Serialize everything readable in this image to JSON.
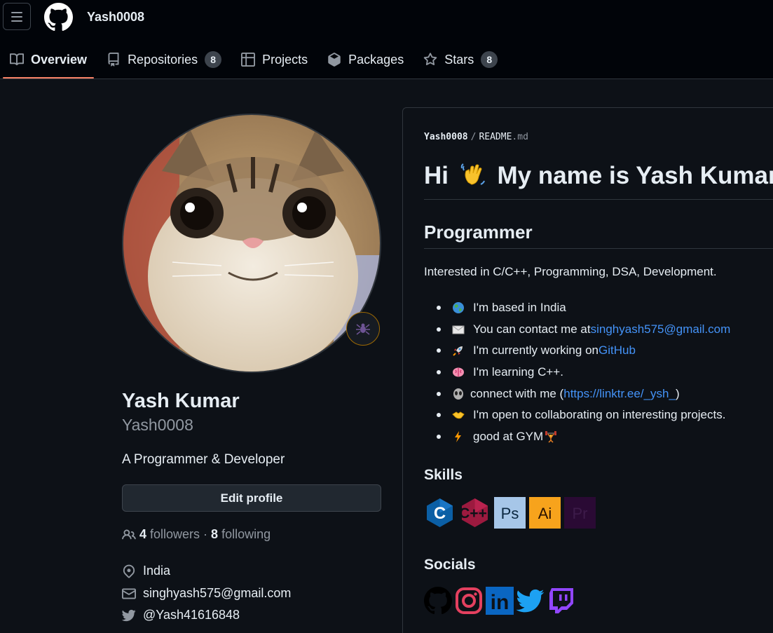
{
  "header": {
    "username": "Yash0008",
    "tabs": [
      {
        "label": "Overview",
        "count": null
      },
      {
        "label": "Repositories",
        "count": "8"
      },
      {
        "label": "Projects",
        "count": null
      },
      {
        "label": "Packages",
        "count": null
      },
      {
        "label": "Stars",
        "count": "8"
      }
    ]
  },
  "profile": {
    "name": "Yash Kumar",
    "login": "Yash0008",
    "bio": "A Programmer & Developer",
    "edit_label": "Edit profile",
    "followers_count": "4",
    "followers_label": "followers",
    "separator": "·",
    "following_count": "8",
    "following_label": "following",
    "location": "India",
    "email": "singhyash575@gmail.com",
    "twitter": "@Yash41616848",
    "status_emoji": "spider-icon"
  },
  "readme": {
    "owner": "Yash0008",
    "file": "README",
    "ext": ".md",
    "title_pre": "Hi",
    "title_post": "My name is Yash Kumar",
    "subtitle": "Programmer",
    "intro": "Interested in C/C++, Programming, DSA, Development.",
    "facts": [
      {
        "icon": "globe-icon",
        "text": "I'm based in India"
      },
      {
        "icon": "envelope-icon",
        "text": "You can contact me at ",
        "link": "singhyash575@gmail.com"
      },
      {
        "icon": "rocket-icon",
        "text": "I'm currently working on ",
        "link": "GitHub"
      },
      {
        "icon": "brain-icon",
        "text": "I'm learning C++."
      },
      {
        "icon": "alien-icon",
        "text": "connect with me (",
        "link": "https://linktr.ee/_ysh_",
        "after": ")"
      },
      {
        "icon": "handshake-icon",
        "text": "I'm open to collaborating on interesting projects."
      },
      {
        "icon": "lightning-icon",
        "text": "good at GYM",
        "trail_icon": "weightlifter-icon"
      }
    ],
    "skills_heading": "Skills",
    "skills": [
      "c-icon",
      "cplusplus-icon",
      "photoshop-icon",
      "illustrator-icon",
      "premiere-icon"
    ],
    "skill_labels": {
      "ps": "Ps",
      "ai": "Ai",
      "pr": "Pr",
      "c": "C",
      "cpp": "C++"
    },
    "socials_heading": "Socials",
    "socials": [
      "github-icon",
      "instagram-icon",
      "linkedin-icon",
      "twitter-icon",
      "twitch-icon"
    ],
    "linkedin_label": "in"
  },
  "colors": {
    "accent_underline": "#f78166",
    "link": "#4493f8",
    "background": "#0d1117",
    "header_bg": "#010409"
  }
}
